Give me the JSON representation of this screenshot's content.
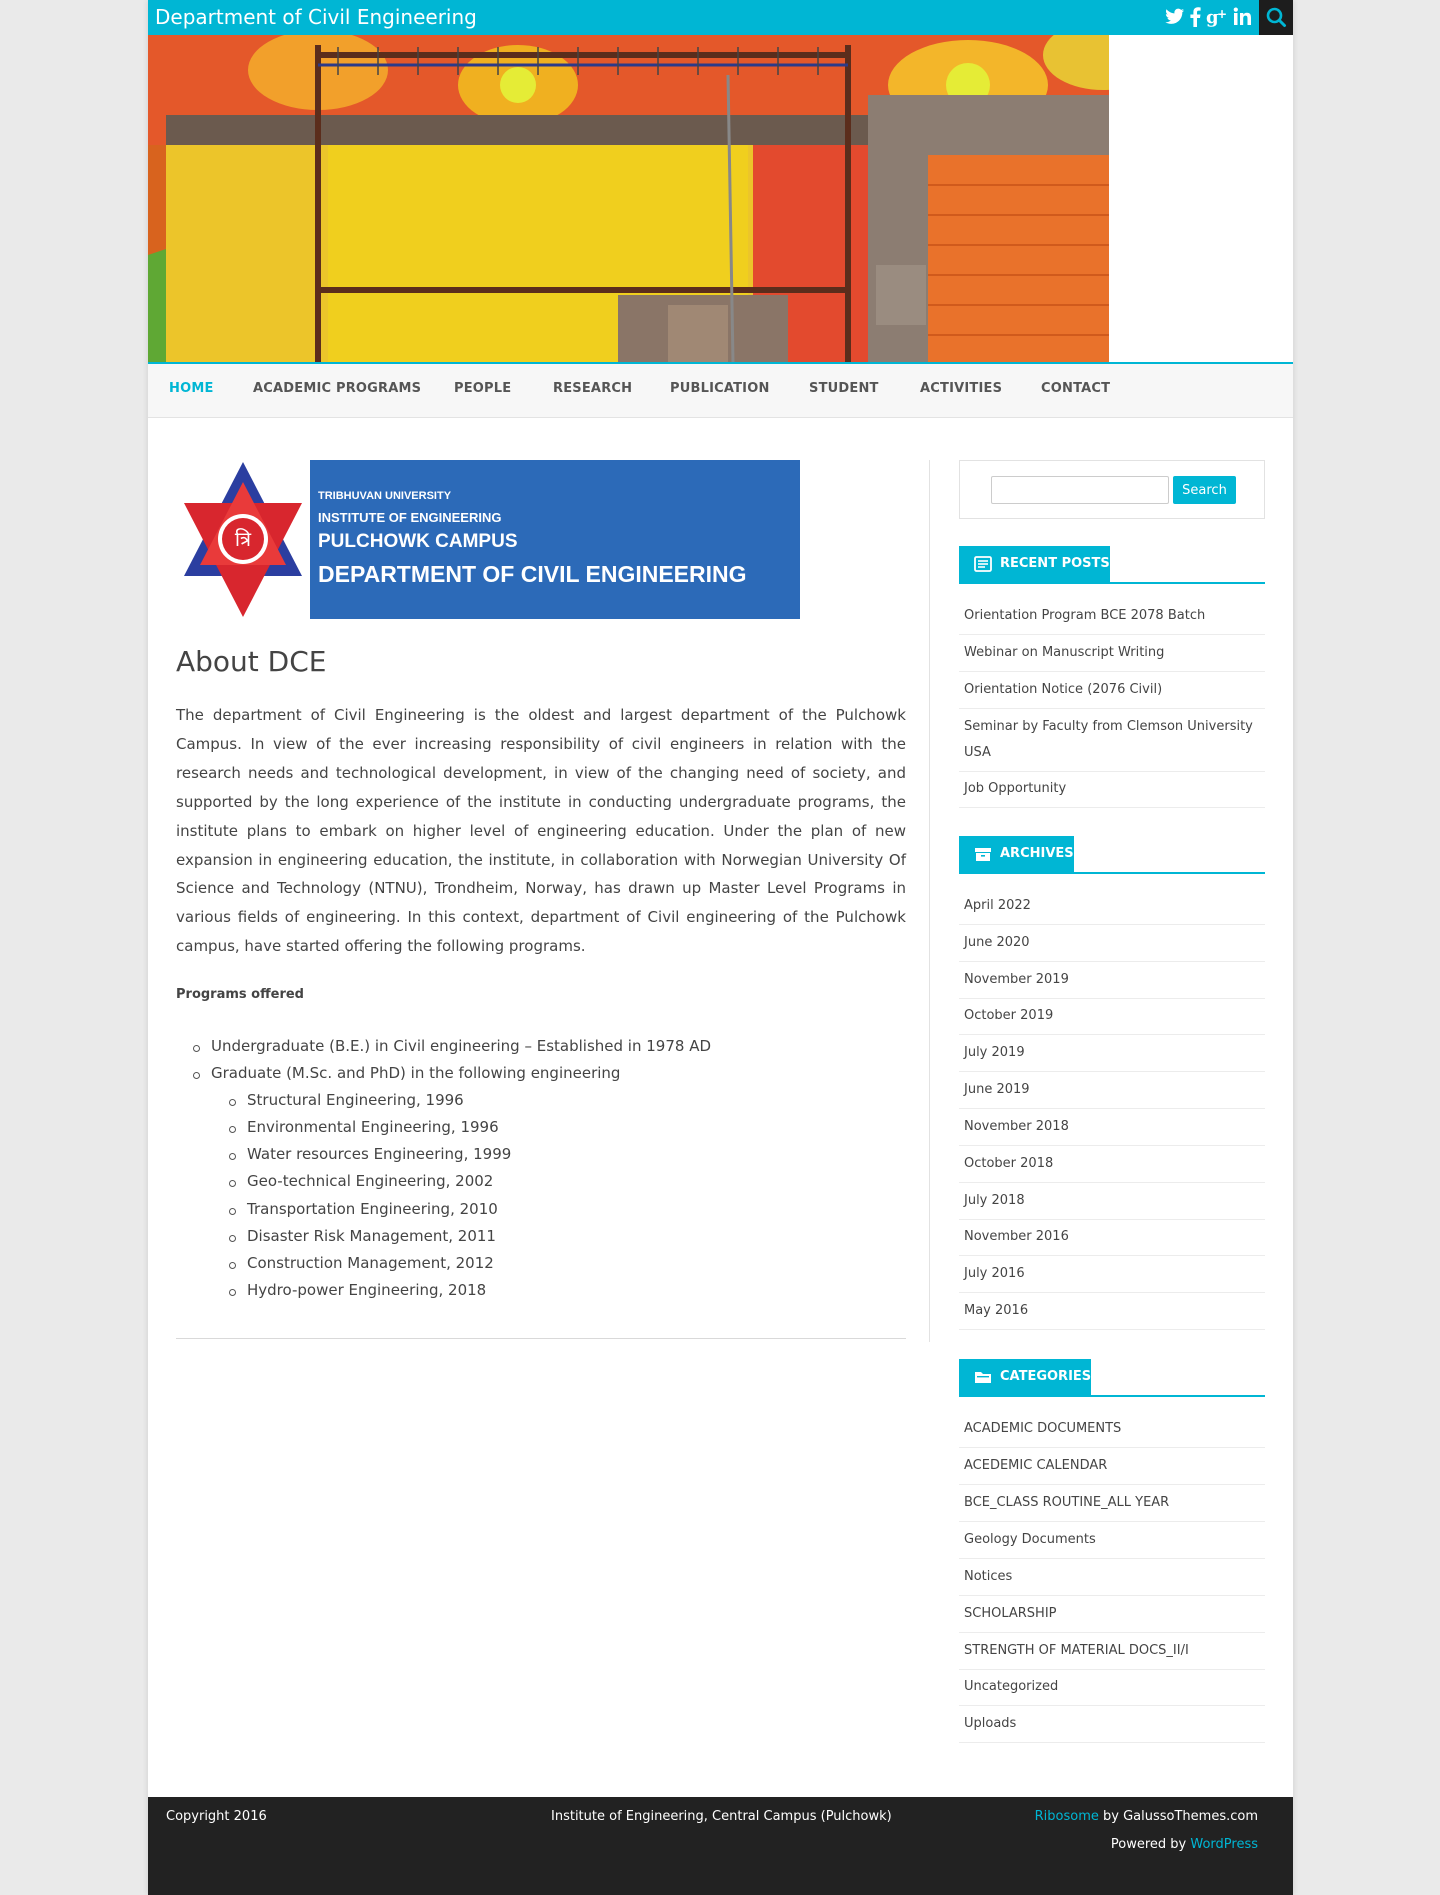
{
  "header": {
    "site_title": "Department of Civil Engineering",
    "social_icons": [
      "twitter-icon",
      "facebook-icon",
      "google-plus-icon",
      "linkedin-icon"
    ],
    "search_icon": "search-icon"
  },
  "nav": {
    "items": [
      "HOME",
      "ACADEMIC PROGRAMS",
      "PEOPLE",
      "RESEARCH",
      "PUBLICATION",
      "STUDENT",
      "ACTIVITIES",
      "CONTACT"
    ],
    "active": "HOME"
  },
  "banner": {
    "line1": "TRIBHUVAN UNIVERSITY",
    "line2": "INSTITUTE OF ENGINEERING",
    "line3": "PULCHOWK CAMPUS",
    "line4": "DEPARTMENT OF CIVIL ENGINEERING"
  },
  "article": {
    "title": "About DCE",
    "body": "The department of Civil Engineering is the oldest and largest department of the Pulchowk Campus. In view of the ever increasing responsibility of civil engineers in relation with the research needs and technological development, in view of the changing need of society, and supported by the long experience of the institute in conducting undergraduate programs, the institute plans to embark on higher level of engineering education. Under the plan of new expansion in engineering education, the institute, in collaboration with Norwegian University Of Science and Technology (NTNU), Trondheim, Norway, has drawn up Master Level Programs in various fields of engineering. In this context, department of Civil engineering of the Pulchowk campus, have started offering the following programs.",
    "programs_heading": "Programs offered",
    "programs": [
      "Undergraduate (B.E.) in Civil engineering – Established in 1978 AD",
      "Graduate (M.Sc. and PhD) in the following engineering"
    ],
    "graduate_programs": [
      "Structural Engineering, 1996",
      "Environmental Engineering, 1996",
      "Water resources Engineering, 1999",
      "Geo-technical Engineering, 2002",
      "Transportation Engineering, 2010",
      "Disaster Risk Management, 2011",
      "Construction Management, 2012",
      "Hydro-power Engineering, 2018"
    ]
  },
  "sidebar": {
    "search": {
      "placeholder": "",
      "button": "Search"
    },
    "recent_posts": {
      "title": "RECENT POSTS",
      "items": [
        "Orientation Program BCE 2078 Batch",
        "Webinar on Manuscript Writing",
        "Orientation Notice (2076 Civil)",
        "Seminar by Faculty from Clemson University USA",
        "Job Opportunity"
      ]
    },
    "archives": {
      "title": "ARCHIVES",
      "items": [
        "April 2022",
        "June 2020",
        "November 2019",
        "October 2019",
        "July 2019",
        "June 2019",
        "November 2018",
        "October 2018",
        "July 2018",
        "November 2016",
        "July 2016",
        "May 2016"
      ]
    },
    "categories": {
      "title": "CATEGORIES",
      "items": [
        "ACADEMIC DOCUMENTS",
        "ACEDEMIC CALENDAR",
        "BCE_CLASS ROUTINE_ALL YEAR",
        "Geology Documents",
        "Notices",
        "SCHOLARSHIP",
        "STRENGTH OF MATERIAL DOCS_II/I",
        "Uncategorized",
        "Uploads"
      ]
    }
  },
  "footer": {
    "copyright": "Copyright 2016",
    "center": "Institute of Engineering, Central Campus (Pulchowk)",
    "theme_link": "Ribosome",
    "theme_by": " by GalussoThemes.com",
    "powered_by": "Powered by ",
    "wordpress_link": "WordPress"
  },
  "colors": {
    "accent": "#00b6d4",
    "footer_bg": "#222222",
    "banner_blue": "#2c6ab8"
  }
}
